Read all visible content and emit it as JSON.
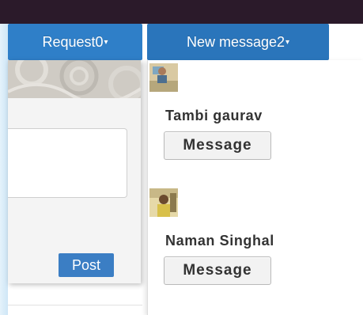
{
  "navbar": {
    "requests_label": "Request0",
    "messages_label": "New message2"
  },
  "composer": {
    "post_label": "Post"
  },
  "message_dropdown": {
    "items": [
      {
        "name": "Tambi gaurav",
        "button_label": "Message"
      },
      {
        "name": "Naman Singhal",
        "button_label": "Message"
      }
    ]
  },
  "colors": {
    "accent": "#2f7fc8",
    "topbar": "#2b1a2a"
  }
}
